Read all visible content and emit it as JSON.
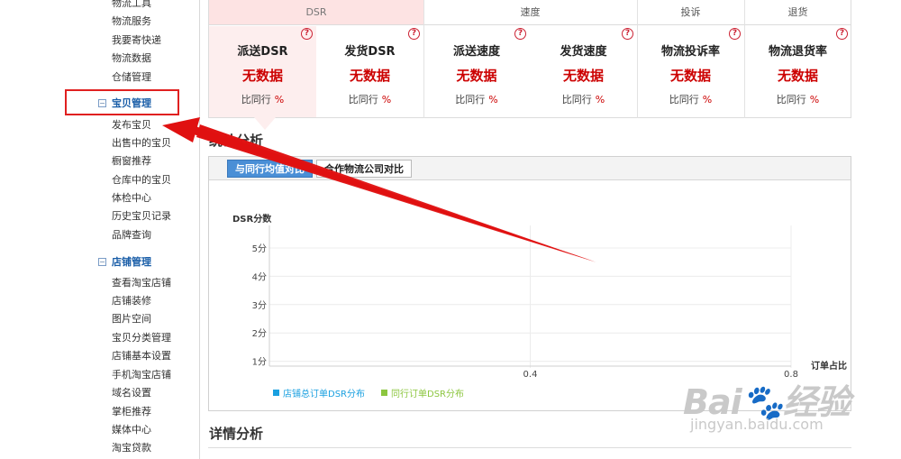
{
  "sidebar": {
    "top_items": [
      "物流工具",
      "物流服务",
      "我要寄快递",
      "物流数据",
      "仓储管理"
    ],
    "sections": [
      {
        "title": "宝贝管理",
        "items": [
          "发布宝贝",
          "出售中的宝贝",
          "橱窗推荐",
          "仓库中的宝贝",
          "体检中心",
          "历史宝贝记录",
          "品牌查询"
        ]
      },
      {
        "title": "店铺管理",
        "items": [
          "查看淘宝店铺",
          "店铺装修",
          "图片空间",
          "宝贝分类管理",
          "店铺基本设置",
          "手机淘宝店铺",
          "域名设置",
          "掌柜推荐",
          "媒体中心",
          "淘宝贷款"
        ]
      }
    ],
    "collapse_symbol": "⊟"
  },
  "metrics": {
    "groups": [
      "DSR",
      "速度",
      "投诉",
      "退货"
    ],
    "help_symbol": "?",
    "cells": [
      {
        "name": "派送DSR",
        "value": "无数据",
        "compare": "比同行",
        "pct": "%"
      },
      {
        "name": "发货DSR",
        "value": "无数据",
        "compare": "比同行",
        "pct": "%"
      },
      {
        "name": "派送速度",
        "value": "无数据",
        "compare": "比同行",
        "pct": "%"
      },
      {
        "name": "发货速度",
        "value": "无数据",
        "compare": "比同行",
        "pct": "%"
      },
      {
        "name": "物流投诉率",
        "value": "无数据",
        "compare": "比同行",
        "pct": "%"
      },
      {
        "name": "物流退货率",
        "value": "无数据",
        "compare": "比同行",
        "pct": "%"
      }
    ]
  },
  "stats": {
    "title": "统计分析",
    "tabs": [
      "与同行均值对比",
      "合作物流公司对比"
    ]
  },
  "chart_data": {
    "type": "scatter",
    "ylabel": "DSR分数",
    "xlabel": "订单占比",
    "yticks": [
      "5分",
      "4分",
      "3分",
      "2分",
      "1分"
    ],
    "xticks": [
      "0.4",
      "0.8"
    ],
    "ylim": [
      0,
      5
    ],
    "xlim": [
      0,
      0.8
    ],
    "grid": true,
    "legend_position": "bottom-left",
    "series": [
      {
        "name": "店铺总订单DSR分布",
        "color": "#1aa0e0",
        "values": []
      },
      {
        "name": "同行订单DSR分布",
        "color": "#8cc63f",
        "values": []
      }
    ]
  },
  "details": {
    "title": "详情分析"
  },
  "watermark": {
    "brand": "Bai🐾经验",
    "url": "jingyan.baidu.com"
  },
  "colors": {
    "accent": "#4a8fd6",
    "highlight": "#e02020",
    "no_data": "#cc0000"
  }
}
